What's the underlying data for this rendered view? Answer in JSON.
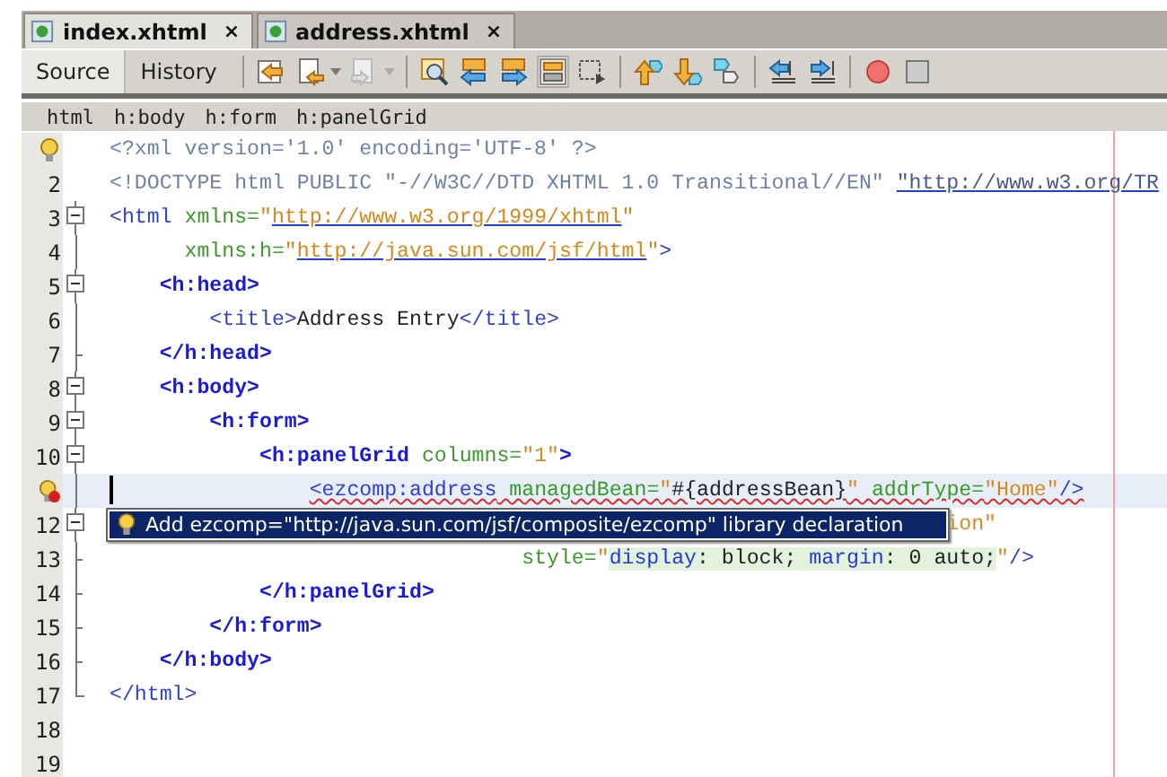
{
  "tabs": [
    {
      "label": "index.xhtml",
      "selected": true,
      "close": "×"
    },
    {
      "label": "address.xhtml",
      "selected": false,
      "close": "×"
    }
  ],
  "view_buttons": [
    {
      "label": "Source",
      "selected": true
    },
    {
      "label": "History",
      "selected": false
    }
  ],
  "breadcrumbs": [
    "html",
    "h:body",
    "h:form",
    "h:panelGrid"
  ],
  "editor": {
    "lines": [
      {
        "hint": true,
        "kind": "plain",
        "current": false,
        "error": false,
        "tokens": [
          {
            "kind": "pi",
            "text": "<?xml version='1.0' encoding='UTF-8' ?>"
          }
        ]
      },
      {
        "number": "2",
        "hint": false,
        "kind": "plain",
        "current": false,
        "error": false,
        "tokens": [
          {
            "kind": "pi",
            "text": "<!DOCTYPE html PUBLIC \"-//W3C//DTD XHTML 1.0 Transitional//EN\" "
          },
          {
            "kind": "pilink",
            "text": "\"http://www.w3.org/TR"
          }
        ]
      },
      {
        "number": "3",
        "hint": false,
        "kind": "fold-start",
        "current": false,
        "error": false,
        "tokens": [
          {
            "kind": "tag",
            "text": "<html"
          },
          {
            "kind": "attr",
            "text": " xmlns="
          },
          {
            "kind": "value",
            "text": "\""
          },
          {
            "kind": "link",
            "text": "http://www.w3.org/1999/xhtml"
          },
          {
            "kind": "value",
            "text": "\""
          }
        ]
      },
      {
        "number": "4",
        "hint": false,
        "kind": "fold-body",
        "current": false,
        "error": false,
        "tokens": [
          {
            "kind": "attr",
            "text": "      xmlns:h="
          },
          {
            "kind": "value",
            "text": "\""
          },
          {
            "kind": "link",
            "text": "http://java.sun.com/jsf/html"
          },
          {
            "kind": "value",
            "text": "\""
          },
          {
            "kind": "tag",
            "text": ">"
          }
        ]
      },
      {
        "number": "5",
        "hint": false,
        "kind": "fold-start",
        "current": false,
        "error": false,
        "tokens": [
          {
            "kind": "tagb",
            "text": "    <h:head>"
          }
        ]
      },
      {
        "number": "6",
        "hint": false,
        "kind": "fold-body",
        "current": false,
        "error": false,
        "tokens": [
          {
            "kind": "tag",
            "text": "        <title>"
          },
          {
            "kind": "text",
            "text": "Address Entry"
          },
          {
            "kind": "tag",
            "text": "</title>"
          }
        ]
      },
      {
        "number": "7",
        "hint": false,
        "kind": "fold-end",
        "current": false,
        "error": false,
        "tokens": [
          {
            "kind": "tagb",
            "text": "    </h:head>"
          }
        ]
      },
      {
        "number": "8",
        "hint": false,
        "kind": "fold-start",
        "current": false,
        "error": false,
        "tokens": [
          {
            "kind": "tagb",
            "text": "    <h:body>"
          }
        ]
      },
      {
        "number": "9",
        "hint": false,
        "kind": "fold-start",
        "current": false,
        "error": false,
        "tokens": [
          {
            "kind": "tagb",
            "text": "        <h:form>"
          }
        ]
      },
      {
        "number": "10",
        "hint": false,
        "kind": "fold-start",
        "current": false,
        "error": false,
        "tokens": [
          {
            "kind": "tagb",
            "text": "            <h:panelGrid"
          },
          {
            "kind": "attr",
            "text": " columns="
          },
          {
            "kind": "value",
            "text": "\"1\""
          },
          {
            "kind": "tagb",
            "text": ">"
          }
        ]
      },
      {
        "hint": true,
        "kind": "fold-body",
        "current": true,
        "error": true,
        "tokens": [
          {
            "kind": "tag",
            "text": "                <ezcomp:address"
          },
          {
            "kind": "attr",
            "text": " managedBean="
          },
          {
            "kind": "value",
            "text": "\""
          },
          {
            "kind": "text",
            "text": "#{addressBean}"
          },
          {
            "kind": "value",
            "text": "\""
          },
          {
            "kind": "attr",
            "text": " addrType="
          },
          {
            "kind": "value",
            "text": "\"Home\""
          },
          {
            "kind": "tag",
            "text": "/>"
          }
        ]
      },
      {
        "number": "12",
        "hint": false,
        "kind": "fold-start",
        "current": false,
        "error": false,
        "tokens": [
          {
            "kind": "value",
            "text": "                                                                   ion\""
          }
        ]
      },
      {
        "number": "13",
        "hint": false,
        "kind": "fold-end",
        "current": false,
        "error": false,
        "tokens": [
          {
            "kind": "attr",
            "text": "                                 style="
          },
          {
            "kind": "value",
            "text": "\""
          },
          {
            "kind": "cssprop",
            "text": "display"
          },
          {
            "kind": "cssval",
            "text": ": block; "
          },
          {
            "kind": "cssprop",
            "text": "margin"
          },
          {
            "kind": "cssval",
            "text": ": 0 auto;"
          },
          {
            "kind": "value",
            "text": "\""
          },
          {
            "kind": "tag",
            "text": "/>"
          }
        ]
      },
      {
        "number": "14",
        "hint": false,
        "kind": "fold-end",
        "current": false,
        "error": false,
        "tokens": [
          {
            "kind": "tagb",
            "text": "            </h:panelGrid>"
          }
        ]
      },
      {
        "number": "15",
        "hint": false,
        "kind": "fold-end",
        "current": false,
        "error": false,
        "tokens": [
          {
            "kind": "tagb",
            "text": "        </h:form>"
          }
        ]
      },
      {
        "number": "16",
        "hint": false,
        "kind": "fold-end",
        "current": false,
        "error": false,
        "tokens": [
          {
            "kind": "tagb",
            "text": "    </h:body>"
          }
        ]
      },
      {
        "number": "17",
        "hint": false,
        "kind": "fold-last",
        "current": false,
        "error": false,
        "tokens": [
          {
            "kind": "tag",
            "text": "</html>"
          }
        ]
      },
      {
        "number": "18",
        "hint": false,
        "kind": "plain"
      },
      {
        "number": "19",
        "hint": false,
        "kind": "plain"
      }
    ],
    "hint_popup": {
      "items": [
        {
          "text": "Add ezcomp=\"http://java.sun.com/jsf/composite/ezcomp\" library declaration",
          "selected": true
        }
      ]
    }
  }
}
